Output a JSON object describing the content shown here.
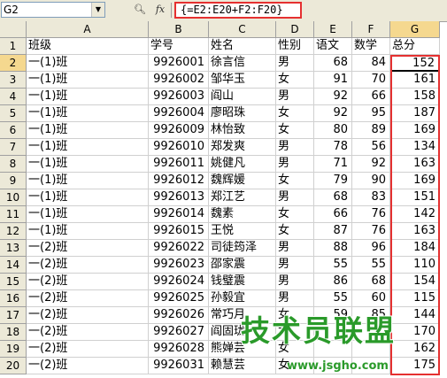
{
  "formula_bar": {
    "name_box": "G2",
    "zoom_icon": "magnify-icon",
    "fx_label": "fx",
    "formula": "{=E2:E20+F2:F20}"
  },
  "columns": [
    "A",
    "B",
    "C",
    "D",
    "E",
    "F",
    "G"
  ],
  "header_row": {
    "row": "1",
    "cells": [
      "班级",
      "学号",
      "姓名",
      "性别",
      "语文",
      "数学",
      "总分"
    ]
  },
  "rows": [
    {
      "row": "2",
      "class": "一(1)班",
      "id": "9926001",
      "name": "徐言信",
      "sex": "男",
      "chinese": "68",
      "math": "84",
      "total": "152"
    },
    {
      "row": "3",
      "class": "一(1)班",
      "id": "9926002",
      "name": "邹华玉",
      "sex": "女",
      "chinese": "91",
      "math": "70",
      "total": "161"
    },
    {
      "row": "4",
      "class": "一(1)班",
      "id": "9926003",
      "name": "阎山",
      "sex": "男",
      "chinese": "92",
      "math": "66",
      "total": "158"
    },
    {
      "row": "5",
      "class": "一(1)班",
      "id": "9926004",
      "name": "廖昭珠",
      "sex": "女",
      "chinese": "92",
      "math": "95",
      "total": "187"
    },
    {
      "row": "6",
      "class": "一(1)班",
      "id": "9926009",
      "name": "林怡致",
      "sex": "女",
      "chinese": "80",
      "math": "89",
      "total": "169"
    },
    {
      "row": "7",
      "class": "一(1)班",
      "id": "9926010",
      "name": "郑发爽",
      "sex": "男",
      "chinese": "78",
      "math": "56",
      "total": "134"
    },
    {
      "row": "8",
      "class": "一(1)班",
      "id": "9926011",
      "name": "姚健凡",
      "sex": "男",
      "chinese": "71",
      "math": "92",
      "total": "163"
    },
    {
      "row": "9",
      "class": "一(1)班",
      "id": "9926012",
      "name": "魏辉媛",
      "sex": "女",
      "chinese": "79",
      "math": "90",
      "total": "169"
    },
    {
      "row": "10",
      "class": "一(1)班",
      "id": "9926013",
      "name": "郑江艺",
      "sex": "男",
      "chinese": "68",
      "math": "83",
      "total": "151"
    },
    {
      "row": "11",
      "class": "一(1)班",
      "id": "9926014",
      "name": "魏素",
      "sex": "女",
      "chinese": "66",
      "math": "76",
      "total": "142"
    },
    {
      "row": "12",
      "class": "一(1)班",
      "id": "9926015",
      "name": "王悦",
      "sex": "女",
      "chinese": "87",
      "math": "76",
      "total": "163"
    },
    {
      "row": "13",
      "class": "一(2)班",
      "id": "9926022",
      "name": "司徒筠泽",
      "sex": "男",
      "chinese": "88",
      "math": "96",
      "total": "184"
    },
    {
      "row": "14",
      "class": "一(2)班",
      "id": "9926023",
      "name": "邵家震",
      "sex": "男",
      "chinese": "55",
      "math": "55",
      "total": "110"
    },
    {
      "row": "15",
      "class": "一(2)班",
      "id": "9926024",
      "name": "钱璧震",
      "sex": "男",
      "chinese": "86",
      "math": "68",
      "total": "154"
    },
    {
      "row": "16",
      "class": "一(2)班",
      "id": "9926025",
      "name": "孙毅宜",
      "sex": "男",
      "chinese": "55",
      "math": "60",
      "total": "115"
    },
    {
      "row": "17",
      "class": "一(2)班",
      "id": "9926026",
      "name": "常巧月",
      "sex": "女",
      "chinese": "59",
      "math": "85",
      "total": "144"
    },
    {
      "row": "18",
      "class": "一(2)班",
      "id": "9926027",
      "name": "阎固珑",
      "sex": "女",
      "chinese": "",
      "math": "",
      "total": "170"
    },
    {
      "row": "19",
      "class": "一(2)班",
      "id": "9926028",
      "name": "熊婵芸",
      "sex": "女",
      "chinese": "",
      "math": "",
      "total": "162"
    },
    {
      "row": "20",
      "class": "一(2)班",
      "id": "9926031",
      "name": "赖慧芸",
      "sex": "女",
      "chinese": "",
      "math": "",
      "total": "175"
    }
  ],
  "watermark": {
    "title": "技术员联盟",
    "url": "www.jsgho.com"
  }
}
